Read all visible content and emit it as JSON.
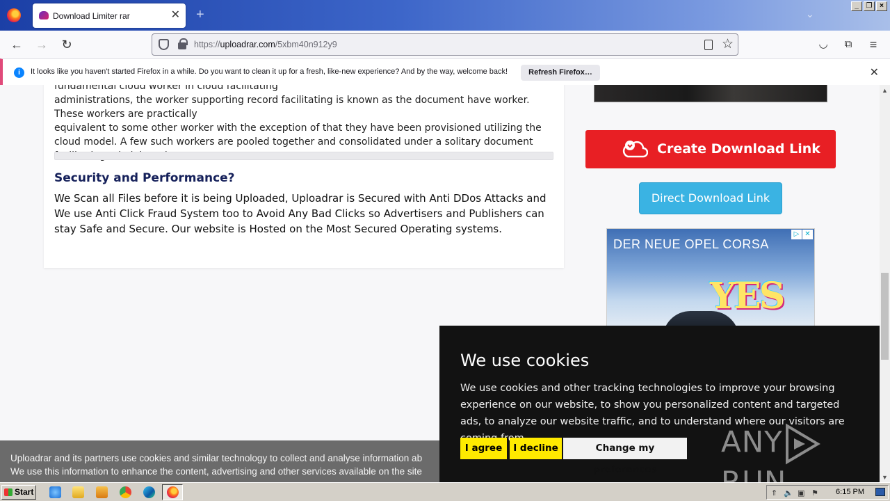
{
  "browser": {
    "tab_title": "Download Limiter rar",
    "url_prefix": "https://",
    "url_domain": "uploadrar.com",
    "url_path": "/5xbm40n912y9"
  },
  "notification": {
    "text": "It looks like you haven't started Firefox in a while. Do you want to clean it up for a fresh, like-new experience? And by the way, welcome back!",
    "button_label": "Refresh Firefox…"
  },
  "article": {
    "para1_line0": "fundamental cloud worker in cloud facilitating",
    "para1_line1": "administrations, the worker supporting record facilitating is known as the document have worker. These workers are practically",
    "para1_line2": "equivalent to some other worker with the exception of that they have been provisioned utilizing the cloud model. A few such workers are pooled together and consolidated under a solitary document facilitating administration.",
    "section_title": "Security and Performance?",
    "para2": "We Scan all Files before it is being Uploaded, Uploadrar is Secured with Anti DDos Attacks and We use Anti Click Fraud System too to Avoid Any Bad Clicks so Advertisers and Publishers can stay Safe and Secure. Our website is Hosted on the Most Secured Operating systems."
  },
  "sidebar": {
    "create_link_label": "Create Download Link",
    "direct_link_label": "Direct Download Link",
    "ad_headline": "DER NEUE OPEL CORSA",
    "ad_slogan": "YES"
  },
  "consent_banner": {
    "line1": "Uploadrar and its partners use cookies and similar technology to collect and analyse information ab",
    "line2": "We use this information to enhance the content, advertising and other services available on the site"
  },
  "cookie_dialog": {
    "title": "We use cookies",
    "body": "We use cookies and other tracking technologies to improve your browsing experience on our website, to show you personalized content and targeted ads, to analyze our website traffic, and to understand where our visitors are coming from.",
    "agree_label": "I agree",
    "decline_label": "I decline",
    "preferences_label": "Change my preferences"
  },
  "watermark": {
    "left": "ANY",
    "right": "RUN"
  },
  "taskbar": {
    "start_label": "Start",
    "clock": "6:15 PM"
  },
  "colors": {
    "create_button": "#e81f24",
    "direct_button": "#3ab3e3",
    "cookie_bg": "#121212",
    "cookie_accept": "#ffea00"
  }
}
